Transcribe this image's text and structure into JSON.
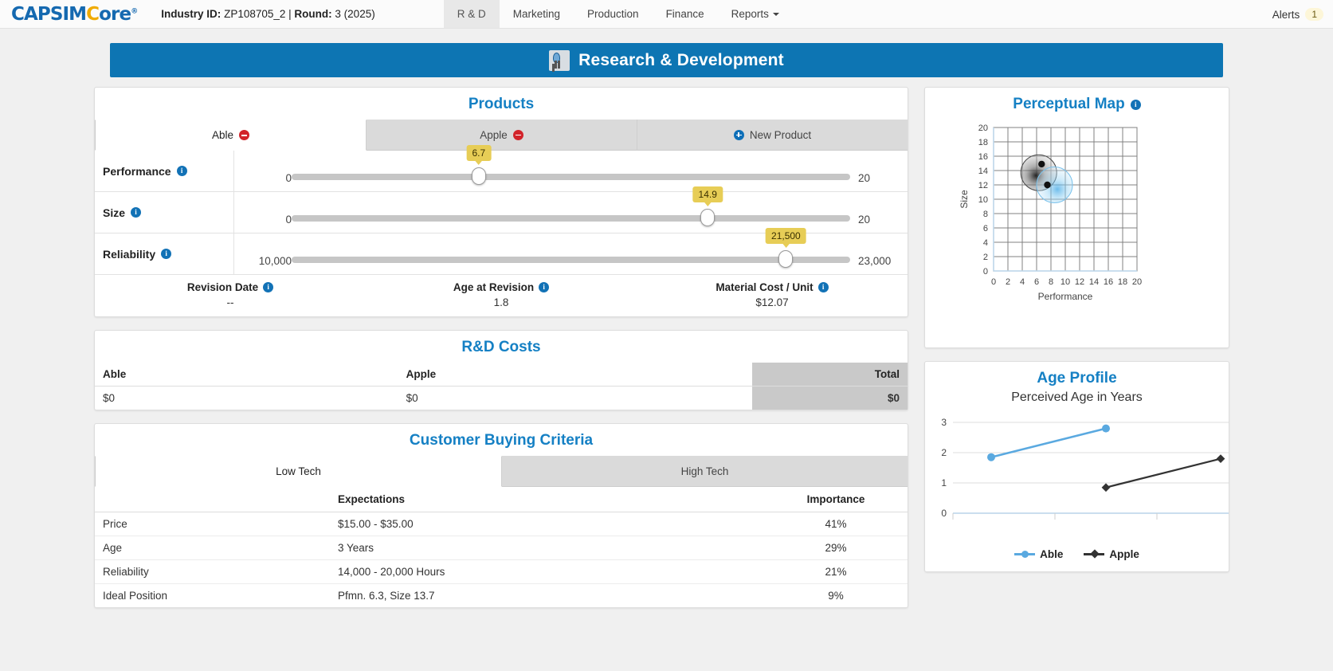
{
  "topbar": {
    "logo": {
      "part1": "CAPSIM",
      "part2": "C",
      "part3": "ore",
      "reg": "®"
    },
    "industry_label": "Industry ID:",
    "industry_value": "ZP108705_2 |",
    "round_label": "Round:",
    "round_value": "3 (2025)",
    "nav": [
      {
        "label": "R & D",
        "active": true
      },
      {
        "label": "Marketing",
        "active": false
      },
      {
        "label": "Production",
        "active": false
      },
      {
        "label": "Finance",
        "active": false
      },
      {
        "label": "Reports",
        "active": false,
        "caret": true
      }
    ],
    "alerts_label": "Alerts",
    "alerts_count": "1"
  },
  "page": {
    "title": "Research & Development"
  },
  "products": {
    "title": "Products",
    "tabs": [
      {
        "label": "Able",
        "icon": "minus-circle-icon",
        "active": true
      },
      {
        "label": "Apple",
        "icon": "minus-circle-icon",
        "active": false
      },
      {
        "label": "New Product",
        "icon": "plus-circle-icon",
        "active": false
      }
    ],
    "sliders": [
      {
        "name": "Performance",
        "min": "0",
        "max": "20",
        "value": "6.7",
        "pct": 33.5
      },
      {
        "name": "Size",
        "min": "0",
        "max": "20",
        "value": "14.9",
        "pct": 74.5
      },
      {
        "name": "Reliability",
        "min": "10,000",
        "max": "23,000",
        "value": "21,500",
        "pct": 88.5
      }
    ],
    "summary": [
      {
        "label": "Revision Date",
        "value": "--"
      },
      {
        "label": "Age at Revision",
        "value": "1.8"
      },
      {
        "label": "Material Cost / Unit",
        "value": "$12.07"
      }
    ]
  },
  "rd_costs": {
    "title": "R&D Costs",
    "headers": [
      "Able",
      "Apple",
      "Total"
    ],
    "values": [
      "$0",
      "$0",
      "$0"
    ]
  },
  "cbc": {
    "title": "Customer Buying Criteria",
    "tabs": [
      {
        "label": "Low Tech",
        "active": true
      },
      {
        "label": "High Tech",
        "active": false
      }
    ],
    "headers": [
      "",
      "Expectations",
      "Importance"
    ],
    "rows": [
      {
        "name": "Price",
        "expectation": "$15.00 - $35.00",
        "importance": "41%"
      },
      {
        "name": "Age",
        "expectation": "3 Years",
        "importance": "29%"
      },
      {
        "name": "Reliability",
        "expectation": "14,000 - 20,000 Hours",
        "importance": "21%"
      },
      {
        "name": "Ideal Position",
        "expectation": "Pfmn. 6.3, Size 13.7",
        "importance": "9%"
      }
    ]
  },
  "chart_data": [
    {
      "type": "scatter",
      "title": "Perceptual Map",
      "xlabel": "Performance",
      "ylabel": "Size",
      "xlim": [
        0,
        20
      ],
      "ylim": [
        0,
        20
      ],
      "xticks": [
        "0",
        "2",
        "4",
        "6",
        "8",
        "10",
        "12",
        "14",
        "16",
        "18",
        "20"
      ],
      "yticks": [
        "0",
        "2",
        "4",
        "6",
        "8",
        "10",
        "12",
        "14",
        "16",
        "18",
        "20"
      ],
      "grid": true,
      "segments": [
        {
          "name": "Low Tech",
          "color": "#555555",
          "cx": 6.3,
          "cy": 13.7,
          "r": 2.5
        },
        {
          "name": "High Tech",
          "color": "#6fbbe8",
          "cx": 8.5,
          "cy": 12.0,
          "r": 2.5
        }
      ],
      "points": [
        {
          "name": "Able",
          "x": 6.7,
          "y": 14.9
        },
        {
          "name": "Apple",
          "x": 7.5,
          "y": 12.0
        }
      ]
    },
    {
      "type": "line",
      "title": "Age Profile",
      "subtitle": "Perceived Age in Years",
      "ylim": [
        0,
        3
      ],
      "yticks": [
        "0",
        "1",
        "2",
        "3"
      ],
      "legend_position": "bottom",
      "series": [
        {
          "name": "Able",
          "color": "#5aa9e0",
          "marker": "circle",
          "x": [
            0.18,
            0.62
          ],
          "values": [
            1.85,
            2.8
          ]
        },
        {
          "name": "Apple",
          "color": "#333333",
          "marker": "diamond",
          "x": [
            0.62,
            1.06
          ],
          "values": [
            0.85,
            1.8
          ]
        }
      ]
    }
  ]
}
